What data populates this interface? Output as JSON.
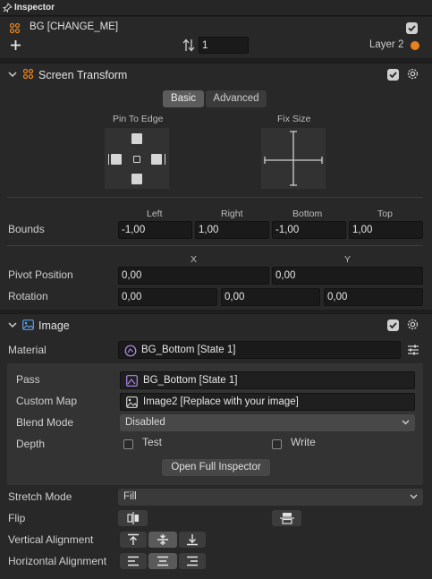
{
  "panel": {
    "title": "Inspector"
  },
  "object": {
    "name": "BG [CHANGE_ME]",
    "order_value": "1",
    "layer_label": "Layer 2",
    "layer_color": "#e8821e",
    "enabled": true
  },
  "screen_transform": {
    "title": "Screen Transform",
    "enabled": true,
    "tabs": [
      {
        "label": "Basic",
        "active": true
      },
      {
        "label": "Advanced",
        "active": false
      }
    ],
    "pin_to_edge_label": "Pin To Edge",
    "fix_size_label": "Fix Size",
    "bounds": {
      "label": "Bounds",
      "headers": [
        "Left",
        "Right",
        "Bottom",
        "Top"
      ],
      "values": [
        "-1,00",
        "1,00",
        "-1,00",
        "1,00"
      ]
    },
    "pivot": {
      "label": "Pivot Position",
      "headers": [
        "X",
        "Y"
      ],
      "values": [
        "0,00",
        "0,00"
      ]
    },
    "rotation": {
      "label": "Rotation",
      "values": [
        "0,00",
        "0,00",
        "0,00"
      ]
    }
  },
  "image": {
    "title": "Image",
    "enabled": true,
    "material": {
      "label": "Material",
      "value": "BG_Bottom [State 1]"
    },
    "pass": {
      "label": "Pass",
      "value": "BG_Bottom [State 1]"
    },
    "custom_map": {
      "label": "Custom Map",
      "value": "Image2 [Replace with your image]"
    },
    "blend_mode": {
      "label": "Blend Mode",
      "value": "Disabled"
    },
    "depth": {
      "label": "Depth",
      "test_label": "Test",
      "write_label": "Write",
      "test_checked": false,
      "write_checked": false
    },
    "open_full_inspector": "Open Full Inspector",
    "stretch_mode": {
      "label": "Stretch Mode",
      "value": "Fill"
    },
    "flip": {
      "label": "Flip"
    },
    "vertical_alignment": {
      "label": "Vertical Alignment",
      "options": [
        "top-align-icon",
        "center-align-icon",
        "bottom-align-icon"
      ],
      "selected": 1
    },
    "horizontal_alignment": {
      "label": "Horizontal Alignment",
      "options": [
        "left-align-icon",
        "center-align-icon",
        "right-align-icon"
      ],
      "selected": 1
    }
  }
}
